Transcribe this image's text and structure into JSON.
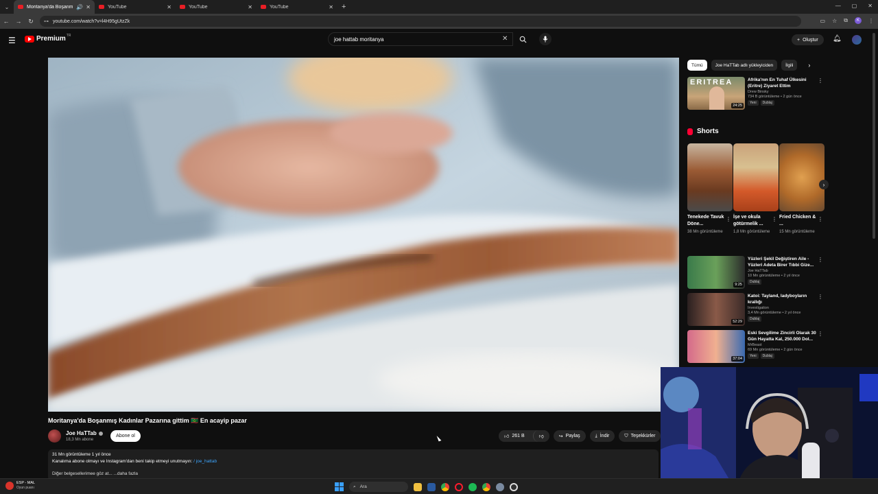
{
  "browser": {
    "tabs": [
      {
        "title": "Moritanya'da Boşanmış Ka",
        "active": true
      },
      {
        "title": "YouTube",
        "active": false
      },
      {
        "title": "YouTube",
        "active": false
      },
      {
        "title": "YouTube",
        "active": false
      }
    ],
    "new_tab": "+",
    "url": "youtube.com/watch?v=l4H95gUtzZk",
    "profile_initial": "K"
  },
  "header": {
    "logo_text": "Premium",
    "logo_region": "TR",
    "search_query": "joe hattab moritanya",
    "create_label": "Oluştur"
  },
  "video": {
    "title": "Moritanya'da Boşanmış Kadınlar Pazarına gittim 🇲🇷 En acayip pazar",
    "channel": "Joe HaTTab",
    "subscribers": "18,3 Mn abone",
    "subscribe_label": "Abone ol",
    "likes": "261 B",
    "share_label": "Paylaş",
    "download_label": "İndir",
    "thanks_label": "Teşekkürler",
    "description": {
      "meta": "31 Mn görüntüleme  1 yıl önce",
      "line1_text": "Kanalıma abone olmayı ve Instagram'dan beni takip etmeyi unutmayın: ",
      "line1_link": "/ joe_hattab",
      "line2": "Diğer belgesellerimee göz at...",
      "more": "...daha fazla"
    }
  },
  "chips": [
    "Tümü",
    "Joe HaTTab adlı yükleyiciden",
    "İlgili"
  ],
  "recommended_top": {
    "title": "Afrika'nın En Tuhaf Ülkesini (Eritre) Ziyaret Ettim",
    "channel": "Drew Binsky",
    "views": "734 B görüntüleme • 2 gün önce",
    "duration": "24:25",
    "badges": [
      "Yeni",
      "Dublaj"
    ],
    "thumb_text": "ERITREA"
  },
  "shorts": {
    "heading": "Shorts",
    "items": [
      {
        "title": "Tenekede Tavuk Döne...",
        "views": "38 Mn görüntüleme"
      },
      {
        "title": "İşe ve okula götürmelik ...",
        "views": "1,8 Mn görüntüleme"
      },
      {
        "title": "Fried Chicken & ...",
        "views": "15 Mn görüntüleme"
      }
    ]
  },
  "recommended": [
    {
      "title": "Yüzleri Şekil Değiştiren Aile - Yüzleri Adeta Birer Tıbbi Gize...",
      "channel": "Joe HaTTab",
      "views": "10 Mn görüntüleme • 2 yıl önce",
      "duration": "9:25",
      "badges": [
        "Dublaj"
      ]
    },
    {
      "title": "Katoi: Tayland, ladyboyların krallığı",
      "channel": "Investigation",
      "views": "3,4 Mn görüntüleme • 2 yıl önce",
      "duration": "52:29",
      "badges": [
        "Dublaj"
      ]
    },
    {
      "title": "Eski Sevgilime Zincirli Olarak 30 Gün Hayatta Kal, 250.000 Dol...",
      "channel": "MrBeast",
      "views": "69 Mn görüntüleme • 2 gün önce",
      "duration": "37:04",
      "badges": [
        "Yeni",
        "Dublaj"
      ]
    }
  ],
  "taskbar": {
    "weather_title": "ESP - MAL",
    "weather_sub": "Oyun puanı",
    "search_placeholder": "Ara"
  },
  "colors": {
    "background": "#0f0f0f",
    "accent_red": "#ff0000",
    "link_blue": "#3ea6ff"
  }
}
